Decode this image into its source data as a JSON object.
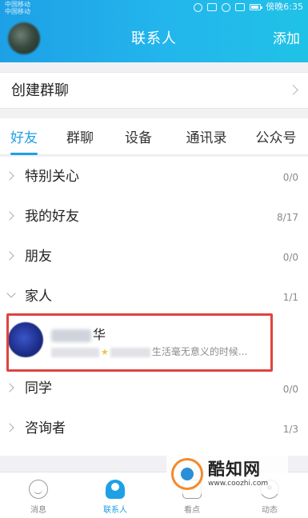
{
  "status_bar": {
    "carrier_1": "中国移动",
    "carrier_2": "中国移动",
    "time_text": "傍晚6:35"
  },
  "header": {
    "title": "联系人",
    "add_label": "添加"
  },
  "create_group": {
    "label": "创建群聊"
  },
  "tabs": [
    {
      "label": "好友",
      "active": true
    },
    {
      "label": "群聊"
    },
    {
      "label": "设备"
    },
    {
      "label": "通讯录"
    },
    {
      "label": "公众号"
    }
  ],
  "groups": [
    {
      "name": "特别关心",
      "count": "0/0",
      "expanded": false
    },
    {
      "name": "我的好友",
      "count": "8/17",
      "expanded": false
    },
    {
      "name": "朋友",
      "count": "0/0",
      "expanded": false
    },
    {
      "name": "家人",
      "count": "1/1",
      "expanded": true
    },
    {
      "name": "同学",
      "count": "0/0",
      "expanded": false
    },
    {
      "name": "咨询者",
      "count": "1/3",
      "expanded": false
    }
  ],
  "contact": {
    "name_visible": "华",
    "signature_visible": "生活毫无意义的时候..."
  },
  "bottom_nav": [
    {
      "label": "消息",
      "icon": "message-icon"
    },
    {
      "label": "联系人",
      "icon": "contacts-icon",
      "active": true
    },
    {
      "label": "看点",
      "icon": "watch-icon"
    },
    {
      "label": "动态",
      "icon": "feed-icon"
    }
  ],
  "watermark": {
    "title": "酷知网",
    "url": "www.coozhi.com"
  },
  "colors": {
    "accent": "#1ea0e6",
    "highlight_box": "#e0433e"
  }
}
